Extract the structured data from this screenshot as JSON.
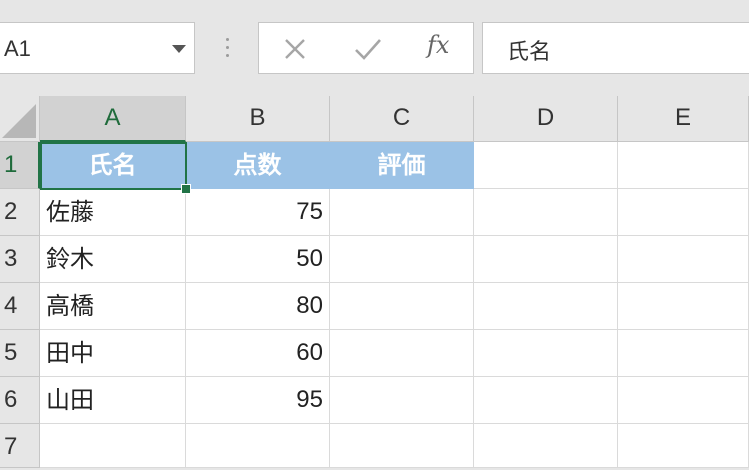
{
  "namebox": {
    "value": "A1"
  },
  "formula_bar": {
    "value": "氏名",
    "fx_label": "fx"
  },
  "columns": [
    "A",
    "B",
    "C",
    "D",
    "E"
  ],
  "rows": [
    "1",
    "2",
    "3",
    "4",
    "5",
    "6",
    "7"
  ],
  "cells": [
    [
      "氏名",
      "点数",
      "評価",
      "",
      ""
    ],
    [
      "佐藤",
      "75",
      "",
      "",
      ""
    ],
    [
      "鈴木",
      "50",
      "",
      "",
      ""
    ],
    [
      "高橋",
      "80",
      "",
      "",
      ""
    ],
    [
      "田中",
      "60",
      "",
      "",
      ""
    ],
    [
      "山田",
      "95",
      "",
      "",
      ""
    ],
    [
      "",
      "",
      "",
      "",
      ""
    ]
  ],
  "colors": {
    "header_fill": "#9bc2e6",
    "selection": "#217346"
  },
  "icons": [
    "chevron-down-icon",
    "cancel-icon",
    "enter-check-icon",
    "fx-icon"
  ]
}
